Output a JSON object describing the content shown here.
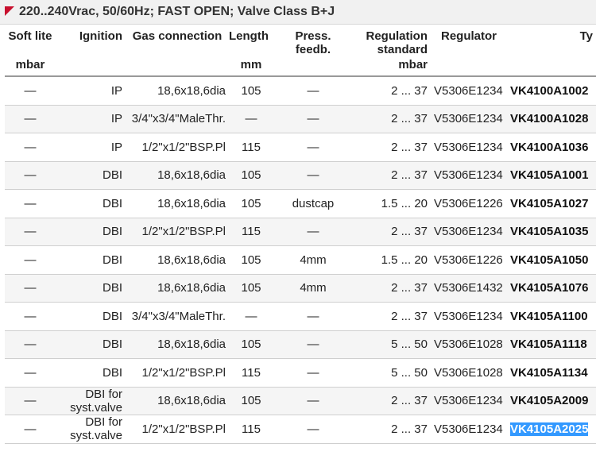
{
  "title": "220..240Vrac, 50/60Hz; FAST OPEN; Valve Class B+J",
  "columns": {
    "soft_lite": "Soft lite",
    "ignition": "Ignition",
    "gas_connection": "Gas connection",
    "length": "Length",
    "press_feedb": "Press. feedb.",
    "regulation_standard": "Regulation standard",
    "regulator": "Regulator",
    "type": "Ty"
  },
  "units": {
    "soft_lite": "mbar",
    "length": "mm",
    "regulation_standard": "mbar"
  },
  "rows": [
    {
      "soft": "—",
      "ignition": "IP",
      "gas": "18,6x18,6dia",
      "length": "105",
      "press": "—",
      "reg_std": "2 ... 37",
      "regulator": "V5306E1234",
      "type": "VK4100A1002"
    },
    {
      "soft": "—",
      "ignition": "IP",
      "gas": "3/4\"x3/4\"MaleThr.",
      "length": "—",
      "press": "—",
      "reg_std": "2 ... 37",
      "regulator": "V5306E1234",
      "type": "VK4100A1028"
    },
    {
      "soft": "—",
      "ignition": "IP",
      "gas": "1/2\"x1/2\"BSP.Pl",
      "length": "115",
      "press": "—",
      "reg_std": "2 ... 37",
      "regulator": "V5306E1234",
      "type": "VK4100A1036"
    },
    {
      "soft": "—",
      "ignition": "DBI",
      "gas": "18,6x18,6dia",
      "length": "105",
      "press": "—",
      "reg_std": "2 ... 37",
      "regulator": "V5306E1234",
      "type": "VK4105A1001"
    },
    {
      "soft": "—",
      "ignition": "DBI",
      "gas": "18,6x18,6dia",
      "length": "105",
      "press": "dustcap",
      "reg_std": "1.5 ... 20",
      "regulator": "V5306E1226",
      "type": "VK4105A1027"
    },
    {
      "soft": "—",
      "ignition": "DBI",
      "gas": "1/2\"x1/2\"BSP.Pl",
      "length": "115",
      "press": "—",
      "reg_std": "2 ... 37",
      "regulator": "V5306E1234",
      "type": "VK4105A1035"
    },
    {
      "soft": "—",
      "ignition": "DBI",
      "gas": "18,6x18,6dia",
      "length": "105",
      "press": "4mm",
      "reg_std": "1.5 ... 20",
      "regulator": "V5306E1226",
      "type": "VK4105A1050"
    },
    {
      "soft": "—",
      "ignition": "DBI",
      "gas": "18,6x18,6dia",
      "length": "105",
      "press": "4mm",
      "reg_std": "2 ... 37",
      "regulator": "V5306E1432",
      "type": "VK4105A1076"
    },
    {
      "soft": "—",
      "ignition": "DBI",
      "gas": "3/4\"x3/4\"MaleThr.",
      "length": "—",
      "press": "—",
      "reg_std": "2 ... 37",
      "regulator": "V5306E1234",
      "type": "VK4105A1100"
    },
    {
      "soft": "—",
      "ignition": "DBI",
      "gas": "18,6x18,6dia",
      "length": "105",
      "press": "—",
      "reg_std": "5 ... 50",
      "regulator": "V5306E1028",
      "type": "VK4105A1118"
    },
    {
      "soft": "—",
      "ignition": "DBI",
      "gas": "1/2\"x1/2\"BSP.Pl",
      "length": "115",
      "press": "—",
      "reg_std": "5 ... 50",
      "regulator": "V5306E1028",
      "type": "VK4105A1134"
    },
    {
      "soft": "—",
      "ignition": "DBI for syst.valve",
      "gas": "18,6x18,6dia",
      "length": "105",
      "press": "—",
      "reg_std": "2 ... 37",
      "regulator": "V5306E1234",
      "type": "VK4105A2009"
    },
    {
      "soft": "—",
      "ignition": "DBI for syst.valve",
      "gas": "1/2\"x1/2\"BSP.Pl",
      "length": "115",
      "press": "—",
      "reg_std": "2 ... 37",
      "regulator": "V5306E1234",
      "type": "VK4105A2025",
      "selected": true
    }
  ],
  "colors": {
    "accent": "#c8102e",
    "selection": "#3399ff"
  }
}
